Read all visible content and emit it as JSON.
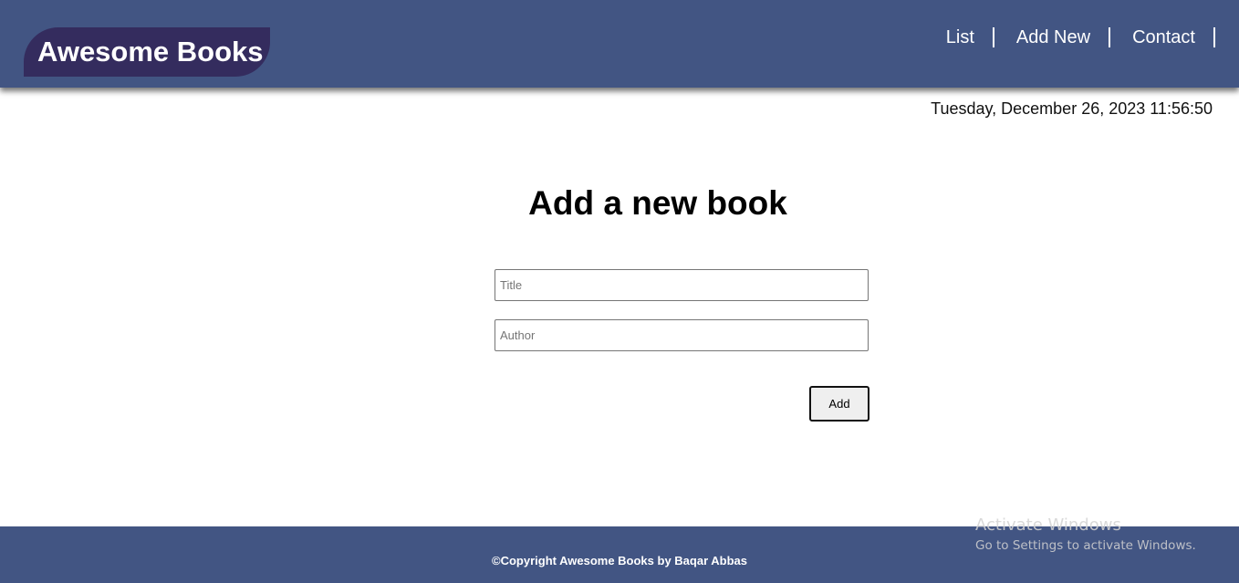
{
  "header": {
    "logo": "Awesome Books",
    "nav": [
      {
        "label": "List"
      },
      {
        "label": "Add New"
      },
      {
        "label": "Contact"
      }
    ]
  },
  "datetime": "Tuesday, December 26, 2023 11:56:50",
  "form": {
    "heading": "Add a new book",
    "title_placeholder": "Title",
    "author_placeholder": "Author",
    "title_value": "",
    "author_value": "",
    "add_label": "Add"
  },
  "footer": {
    "copyright": "©Copyright Awesome Books by Baqar Abbas"
  },
  "os_watermark": {
    "title": "Activate Windows",
    "subtitle": "Go to Settings to activate Windows."
  },
  "colors": {
    "header_bg": "#425583",
    "logo_bg": "#342c5e",
    "footer_bg": "#425583"
  }
}
